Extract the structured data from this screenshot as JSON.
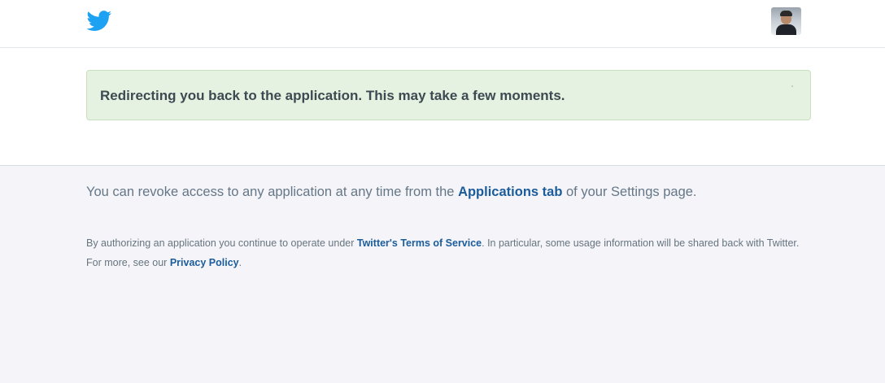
{
  "header": {
    "logo_icon": "twitter-bird-icon",
    "avatar_icon": "user-avatar"
  },
  "alert": {
    "message": "Redirecting you back to the application. This may take a few moments."
  },
  "footer": {
    "revoke_prefix": "You can revoke access to any application at any time from the ",
    "revoke_link": "Applications tab",
    "revoke_suffix": " of your Settings page.",
    "terms_prefix": "By authorizing an application you continue to operate under ",
    "terms_link": "Twitter's Terms of Service",
    "terms_middle": ". In particular, some usage information will be shared back with Twitter. For more, see our ",
    "privacy_link": "Privacy Policy",
    "terms_suffix": "."
  },
  "colors": {
    "brand_blue": "#1da1f2",
    "link_blue": "#1b5c9a",
    "alert_background": "#e6f2e1",
    "alert_border": "#c8e0bd",
    "footer_background": "#f4f4f9"
  }
}
